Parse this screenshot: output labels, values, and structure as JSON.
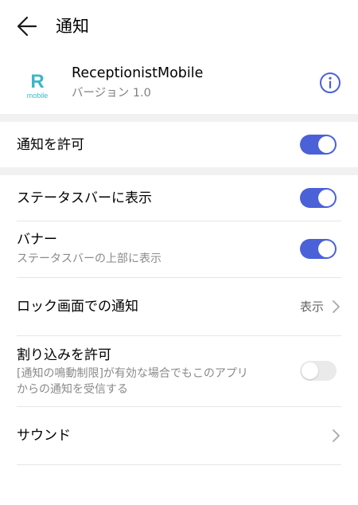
{
  "header": {
    "title": "通知"
  },
  "app": {
    "name": "ReceptionistMobile",
    "version": "バージョン 1.0",
    "logo_letter": "R",
    "logo_sub": "mobile"
  },
  "settings": {
    "allow_notifications": {
      "label": "通知を許可",
      "enabled": true
    },
    "status_bar": {
      "label": "ステータスバーに表示",
      "enabled": true
    },
    "banner": {
      "label": "バナー",
      "description": "ステータスバーの上部に表示",
      "enabled": true
    },
    "lock_screen": {
      "label": "ロック画面での通知",
      "value": "表示"
    },
    "interrupt": {
      "label": "割り込みを許可",
      "description_line1": "[通知の鳴動制限]が有効な場合でもこのアプリ",
      "description_line2": "からの通知を受信する",
      "enabled": false
    },
    "sound": {
      "label": "サウンド"
    }
  },
  "colors": {
    "accent": "#4a61d8",
    "logo": "#3cb6c8",
    "toggle_off": "#eaeaea",
    "separator": "#f1f1f1"
  }
}
